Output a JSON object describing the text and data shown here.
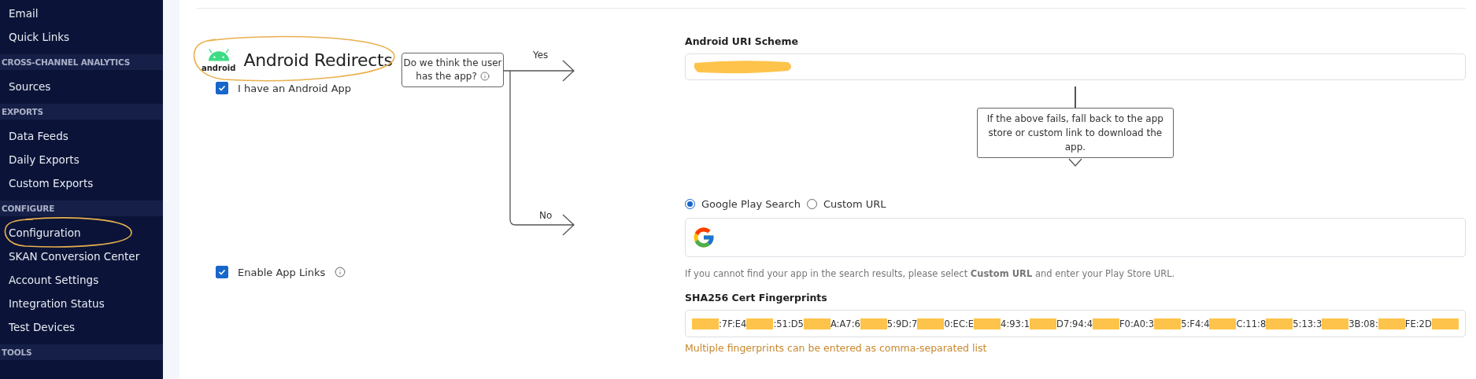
{
  "sidebar": {
    "sections": [
      {
        "items": [
          {
            "label": "Email",
            "circled": false
          },
          {
            "label": "Quick Links",
            "circled": false
          }
        ]
      },
      {
        "title": "CROSS-CHANNEL ANALYTICS",
        "items": [
          {
            "label": "Sources",
            "circled": false
          }
        ]
      },
      {
        "title": "EXPORTS",
        "items": [
          {
            "label": "Data Feeds",
            "circled": false
          },
          {
            "label": "Daily Exports",
            "circled": false
          },
          {
            "label": "Custom Exports",
            "circled": false
          }
        ]
      },
      {
        "title": "CONFIGURE",
        "items": [
          {
            "label": "Configuration",
            "circled": true
          },
          {
            "label": "SKAN Conversion Center",
            "circled": false
          },
          {
            "label": "Account Settings",
            "circled": false
          },
          {
            "label": "Integration Status",
            "circled": false
          },
          {
            "label": "Test Devices",
            "circled": false
          }
        ]
      },
      {
        "title": "TOOLS"
      }
    ]
  },
  "section": {
    "logo_text": "android",
    "title": "Android Redirects",
    "title_circled": true,
    "android_app": {
      "label": "I have an Android App",
      "checked": true
    },
    "app_links": {
      "label": "Enable App Links",
      "checked": true
    },
    "flow": {
      "question": "Do we think the user has the app?",
      "yes": "Yes",
      "no": "No",
      "fallback": "If the above fails, fall back to the app store or custom link to download the app."
    },
    "uri_scheme": {
      "label": "Android URI Scheme",
      "redacted": true
    },
    "store_source": [
      {
        "label": "Google Play Search",
        "selected": true
      },
      {
        "label": "Custom URL",
        "selected": false
      }
    ],
    "hint": "If you cannot find your app in the search results, please select **Custom URL** and enter your Play Store URL.",
    "fingerprints": {
      "label": "SHA256 Cert Fingerprints",
      "fragments": [
        ":7F:E4",
        ":51:D5",
        "A:A7:6",
        "5:9D:7",
        "0:EC:E",
        "4:93:1",
        "D7:94:4",
        "F0:A0:3",
        "5:F4:4",
        "C:11:8",
        "5:13:3",
        "3B:08:",
        "FE:2D"
      ],
      "note": "Multiple fingerprints can be entered as comma-separated list"
    }
  }
}
